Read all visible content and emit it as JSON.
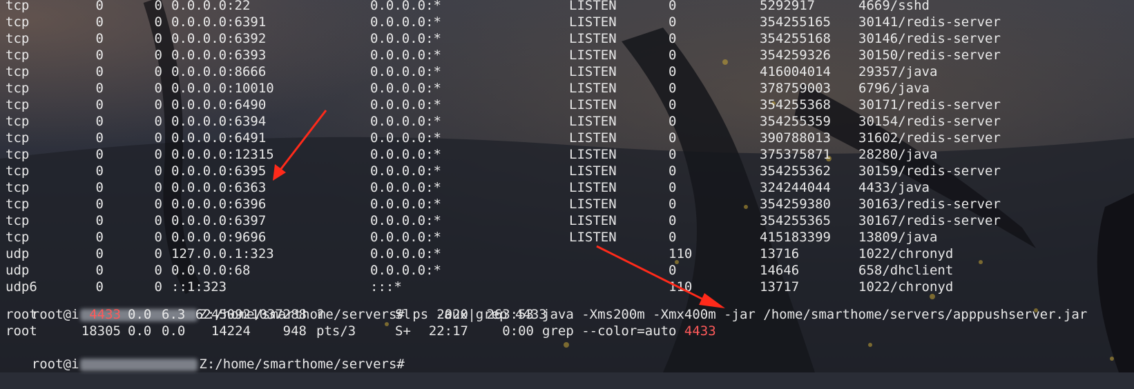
{
  "netstat": [
    {
      "proto": "tcp",
      "recvq": "0",
      "sendq": "0",
      "local": "0.0.0.0:22",
      "foreign": "0.0.0.0:*",
      "state": "LISTEN",
      "user": "0",
      "inode": "5292917",
      "program": "4669/sshd"
    },
    {
      "proto": "tcp",
      "recvq": "0",
      "sendq": "0",
      "local": "0.0.0.0:6391",
      "foreign": "0.0.0.0:*",
      "state": "LISTEN",
      "user": "0",
      "inode": "354255165",
      "program": "30141/redis-server"
    },
    {
      "proto": "tcp",
      "recvq": "0",
      "sendq": "0",
      "local": "0.0.0.0:6392",
      "foreign": "0.0.0.0:*",
      "state": "LISTEN",
      "user": "0",
      "inode": "354255168",
      "program": "30146/redis-server"
    },
    {
      "proto": "tcp",
      "recvq": "0",
      "sendq": "0",
      "local": "0.0.0.0:6393",
      "foreign": "0.0.0.0:*",
      "state": "LISTEN",
      "user": "0",
      "inode": "354259326",
      "program": "30150/redis-server"
    },
    {
      "proto": "tcp",
      "recvq": "0",
      "sendq": "0",
      "local": "0.0.0.0:8666",
      "foreign": "0.0.0.0:*",
      "state": "LISTEN",
      "user": "0",
      "inode": "416004014",
      "program": "29357/java"
    },
    {
      "proto": "tcp",
      "recvq": "0",
      "sendq": "0",
      "local": "0.0.0.0:10010",
      "foreign": "0.0.0.0:*",
      "state": "LISTEN",
      "user": "0",
      "inode": "378759003",
      "program": "6796/java"
    },
    {
      "proto": "tcp",
      "recvq": "0",
      "sendq": "0",
      "local": "0.0.0.0:6490",
      "foreign": "0.0.0.0:*",
      "state": "LISTEN",
      "user": "0",
      "inode": "354255368",
      "program": "30171/redis-server"
    },
    {
      "proto": "tcp",
      "recvq": "0",
      "sendq": "0",
      "local": "0.0.0.0:6394",
      "foreign": "0.0.0.0:*",
      "state": "LISTEN",
      "user": "0",
      "inode": "354255359",
      "program": "30154/redis-server"
    },
    {
      "proto": "tcp",
      "recvq": "0",
      "sendq": "0",
      "local": "0.0.0.0:6491",
      "foreign": "0.0.0.0:*",
      "state": "LISTEN",
      "user": "0",
      "inode": "390788013",
      "program": "31602/redis-server"
    },
    {
      "proto": "tcp",
      "recvq": "0",
      "sendq": "0",
      "local": "0.0.0.0:12315",
      "foreign": "0.0.0.0:*",
      "state": "LISTEN",
      "user": "0",
      "inode": "375375871",
      "program": "28280/java"
    },
    {
      "proto": "tcp",
      "recvq": "0",
      "sendq": "0",
      "local": "0.0.0.0:6395",
      "foreign": "0.0.0.0:*",
      "state": "LISTEN",
      "user": "0",
      "inode": "354255362",
      "program": "30159/redis-server"
    },
    {
      "proto": "tcp",
      "recvq": "0",
      "sendq": "0",
      "local": "0.0.0.0:6363",
      "foreign": "0.0.0.0:*",
      "state": "LISTEN",
      "user": "0",
      "inode": "324244044",
      "program": "4433/java"
    },
    {
      "proto": "tcp",
      "recvq": "0",
      "sendq": "0",
      "local": "0.0.0.0:6396",
      "foreign": "0.0.0.0:*",
      "state": "LISTEN",
      "user": "0",
      "inode": "354259380",
      "program": "30163/redis-server"
    },
    {
      "proto": "tcp",
      "recvq": "0",
      "sendq": "0",
      "local": "0.0.0.0:6397",
      "foreign": "0.0.0.0:*",
      "state": "LISTEN",
      "user": "0",
      "inode": "354255365",
      "program": "30167/redis-server"
    },
    {
      "proto": "tcp",
      "recvq": "0",
      "sendq": "0",
      "local": "0.0.0.0:9696",
      "foreign": "0.0.0.0:*",
      "state": "LISTEN",
      "user": "0",
      "inode": "415183399",
      "program": "13809/java"
    },
    {
      "proto": "udp",
      "recvq": "0",
      "sendq": "0",
      "local": "127.0.0.1:323",
      "foreign": "0.0.0.0:*",
      "state": "",
      "user": "110",
      "inode": "13716",
      "program": "1022/chronyd"
    },
    {
      "proto": "udp",
      "recvq": "0",
      "sendq": "0",
      "local": "0.0.0.0:68",
      "foreign": "0.0.0.0:*",
      "state": "",
      "user": "0",
      "inode": "14646",
      "program": "658/dhclient"
    },
    {
      "proto": "udp6",
      "recvq": "0",
      "sendq": "0",
      "local": "::1:323",
      "foreign": ":::*",
      "state": "",
      "user": "110",
      "inode": "13717",
      "program": "1022/chronyd"
    }
  ],
  "prompt1": {
    "user_prefix": "root@i",
    "path_suffix": "Z:/home/smarthome/servers#",
    "command": "ps -aux|grep 4433"
  },
  "ps": [
    {
      "user": "root",
      "pid": "4433",
      "cpu": "0.0",
      "mem": "6.3",
      "vsz": "6245092",
      "rss": "1037288",
      "tty": "?",
      "stat": "Sl",
      "start": "2020",
      "time": "263:53",
      "cmd_before": "java -Xms200m -Xmx400m -jar /home/smarthome/servers/apppushserver.jar",
      "cmd_match": ""
    },
    {
      "user": "root",
      "pid": "18305",
      "cpu": "0.0",
      "mem": "0.0",
      "vsz": "14224",
      "rss": "948",
      "tty": "pts/3",
      "stat": "S+",
      "start": "22:17",
      "time": "0:00",
      "cmd_before": "grep --color=auto ",
      "cmd_match": "4433"
    }
  ],
  "prompt2": {
    "user_prefix": "root@i",
    "path_suffix": "Z:/home/smarthome/servers#"
  },
  "colors": {
    "text": "#e8e8e8",
    "grep_match": "#ff5a5a",
    "arrow": "#ff2a1a"
  }
}
